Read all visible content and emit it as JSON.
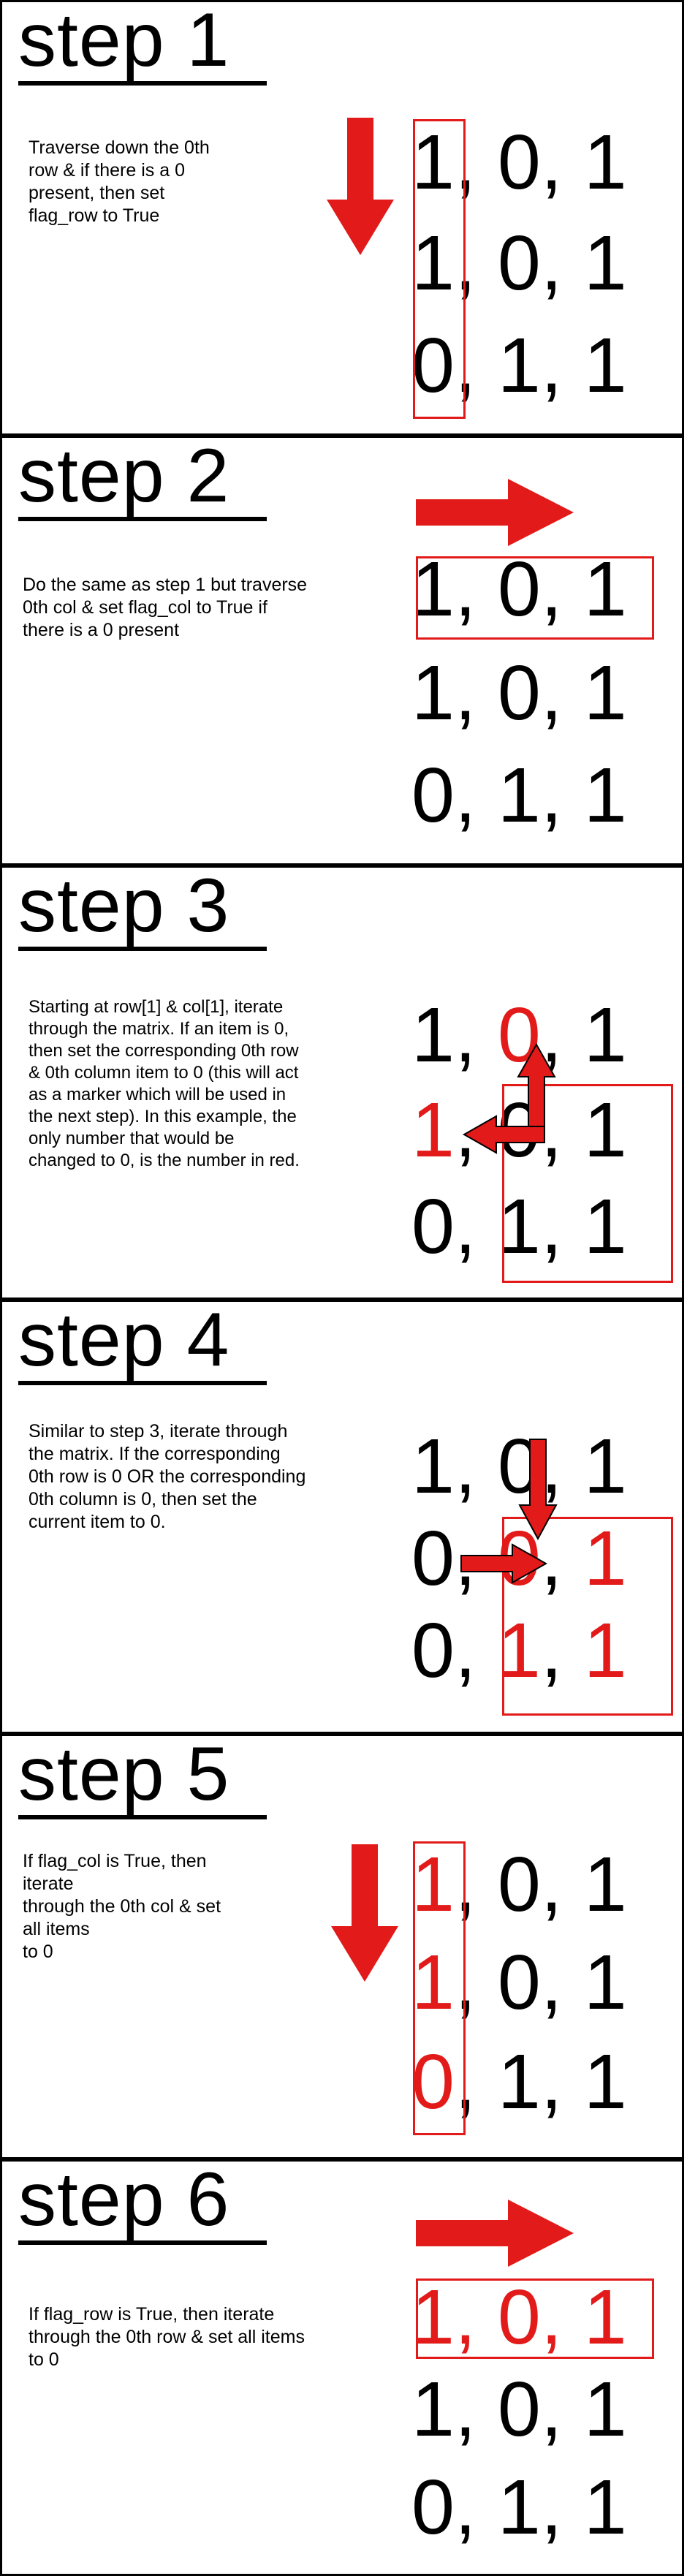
{
  "colors": {
    "accent": "#e21a1a",
    "text": "#000000",
    "border": "#000000"
  },
  "steps": [
    {
      "title": "step 1",
      "description": "Traverse down the 0th\nrow & if there is a 0\npresent, then set\nflag_row to True",
      "matrix": [
        [
          "1",
          "0",
          "1"
        ],
        [
          "1",
          "0",
          "1"
        ],
        [
          "0",
          "1",
          "1"
        ]
      ]
    },
    {
      "title": "step 2",
      "description": "Do the same as step 1 but traverse\n0th col & set flag_col to True if\nthere is a 0 present",
      "matrix": [
        [
          "1",
          "0",
          "1"
        ],
        [
          "1",
          "0",
          "1"
        ],
        [
          "0",
          "1",
          "1"
        ]
      ]
    },
    {
      "title": "step 3",
      "description": "Starting at row[1] & col[1], iterate\nthrough the matrix. If an item is 0,\nthen set the corresponding 0th row\n& 0th column item to 0 (this will act\nas a marker which will be used in\nthe next step). In this example, the\nonly number that would be\nchanged to 0, is the number in red.",
      "matrix": [
        [
          "1",
          "0",
          "1"
        ],
        [
          "1",
          "0",
          "1"
        ],
        [
          "0",
          "1",
          "1"
        ]
      ]
    },
    {
      "title": "step 4",
      "description": "Similar to step 3, iterate through\nthe matrix. If the corresponding\n0th row is 0 OR the corresponding\n0th column is 0, then set the\ncurrent item to 0.",
      "matrix": [
        [
          "1",
          "0",
          "1"
        ],
        [
          "0",
          "0",
          "1"
        ],
        [
          "0",
          "1",
          "1"
        ]
      ]
    },
    {
      "title": "step 5",
      "description": "If flag_col is True, then\niterate\nthrough the 0th col & set\nall items\nto 0",
      "matrix": [
        [
          "1",
          "0",
          "1"
        ],
        [
          "1",
          "0",
          "1"
        ],
        [
          "0",
          "1",
          "1"
        ]
      ]
    },
    {
      "title": "step 6",
      "description": "If flag_row is True, then iterate\nthrough the 0th row & set all items\nto 0",
      "matrix": [
        [
          "1",
          "0",
          "1"
        ],
        [
          "1",
          "0",
          "1"
        ],
        [
          "0",
          "1",
          "1"
        ]
      ]
    }
  ]
}
